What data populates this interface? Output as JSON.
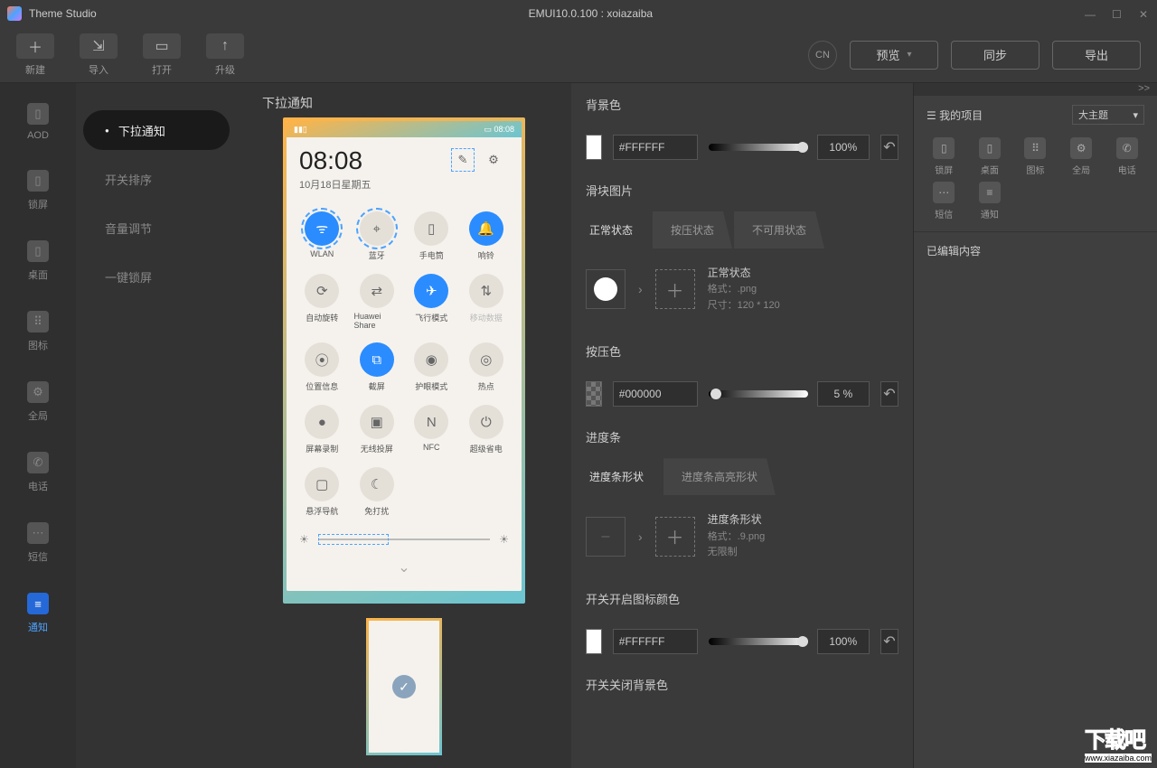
{
  "titlebar": {
    "app": "Theme Studio",
    "doc": "EMUI10.0.100 : xoiazaiba"
  },
  "toolbar": {
    "newLabel": "新建",
    "importLabel": "导入",
    "openLabel": "打开",
    "upgradeLabel": "升级",
    "lang": "CN",
    "preview": "预览",
    "sync": "同步",
    "export": "导出"
  },
  "leftnav": {
    "aod": "AOD",
    "lock": "锁屏",
    "desktop": "桌面",
    "icons": "图标",
    "global": "全局",
    "phone": "电话",
    "sms": "短信",
    "notify": "通知"
  },
  "sublist": {
    "pulldown": "下拉通知",
    "switchOrder": "开关排序",
    "volume": "音量调节",
    "oneKeyLock": "一键锁屏"
  },
  "preview": {
    "title": "下拉通知",
    "statusTime": "08:08",
    "clock": "08:08",
    "date": "10月18日星期五",
    "qs": {
      "wlan": "WLAN",
      "bt": "蓝牙",
      "torch": "手电筒",
      "ring": "响铃",
      "rotate": "自动旋转",
      "share": "Huawei Share",
      "airplane": "飞行模式",
      "data": "移动数据",
      "location": "位置信息",
      "screenshot": "截屏",
      "eye": "护眼模式",
      "hotspot": "热点",
      "record": "屏幕录制",
      "cast": "无线投屏",
      "nfc": "NFC",
      "battery": "超级省电",
      "float": "悬浮导航",
      "dnd": "免打扰"
    }
  },
  "props": {
    "bgColor": {
      "title": "背景色",
      "hex": "#FFFFFF",
      "pct": "100%"
    },
    "slideImg": {
      "title": "滑块图片",
      "tab1": "正常状态",
      "tab2": "按压状态",
      "tab3": "不可用状态",
      "name": "正常状态",
      "fmt": "格式：.png",
      "size": "尺寸：120 * 120"
    },
    "pressColor": {
      "title": "按压色",
      "hex": "#000000",
      "pct": "5  %"
    },
    "progress": {
      "title": "进度条",
      "tab1": "进度条形状",
      "tab2": "进度条高亮形状",
      "name": "进度条形状",
      "fmt": "格式：.9.png",
      "size": "无限制"
    },
    "switchOnColor": {
      "title": "开关开启图标颜色",
      "hex": "#FFFFFF",
      "pct": "100%"
    },
    "switchOffBg": {
      "title": "开关关闭背景色"
    }
  },
  "rproj": {
    "more": ">>",
    "title": "我的项目",
    "dropdown": "大主题",
    "items": {
      "lock": "锁屏",
      "desktop": "桌面",
      "icons": "图标",
      "global": "全局",
      "phone": "电话",
      "sms": "短信",
      "notify": "通知"
    },
    "edited": "已编辑内容"
  },
  "watermark": {
    "big": "下载吧",
    "small": "www.xiazaiba.com"
  }
}
